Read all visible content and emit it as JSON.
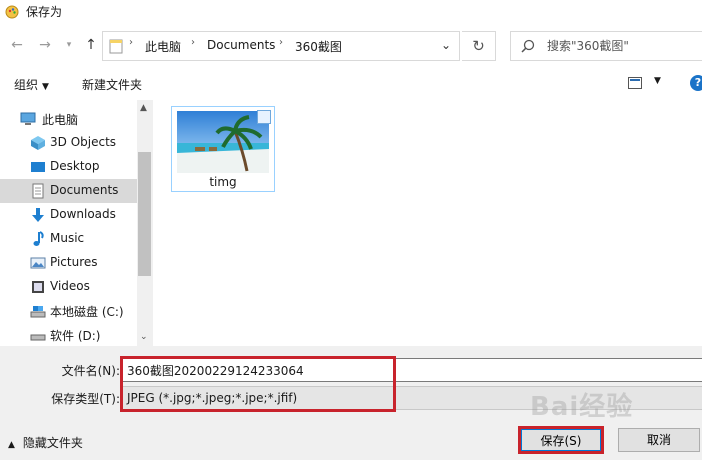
{
  "window": {
    "title": "保存为"
  },
  "address": {
    "crumbs": [
      "此电脑",
      "Documents",
      "360截图"
    ]
  },
  "search": {
    "placeholder": "搜索\"360截图\""
  },
  "toolbar": {
    "organize_label": "组织",
    "new_folder_label": "新建文件夹"
  },
  "nav": {
    "items": [
      {
        "label": "此电脑",
        "icon": "computer-icon"
      },
      {
        "label": "3D Objects",
        "icon": "3d-objects-icon"
      },
      {
        "label": "Desktop",
        "icon": "desktop-icon"
      },
      {
        "label": "Documents",
        "icon": "documents-icon",
        "selected": true
      },
      {
        "label": "Downloads",
        "icon": "downloads-icon"
      },
      {
        "label": "Music",
        "icon": "music-icon"
      },
      {
        "label": "Pictures",
        "icon": "pictures-icon"
      },
      {
        "label": "Videos",
        "icon": "videos-icon"
      },
      {
        "label": "本地磁盘 (C:)",
        "icon": "local-disk-icon"
      },
      {
        "label": "软件 (D:)",
        "icon": "drive-icon"
      }
    ]
  },
  "files": [
    {
      "name": "timg",
      "type": "image"
    }
  ],
  "form": {
    "filename_label": "文件名(N):",
    "filename_value": "360截图20200229124233064",
    "filetype_label": "保存类型(T):",
    "filetype_value": "JPEG (*.jpg;*.jpeg;*.jpe;*.jfif)"
  },
  "footer": {
    "hide_folders_label": "隐藏文件夹",
    "save_label": "保存(S)",
    "cancel_label": "取消"
  },
  "colors": {
    "accent": "#0078d7",
    "highlight": "#c8232c",
    "selection": "#d9d9d9"
  },
  "watermark": {
    "text": "Bai经验"
  }
}
